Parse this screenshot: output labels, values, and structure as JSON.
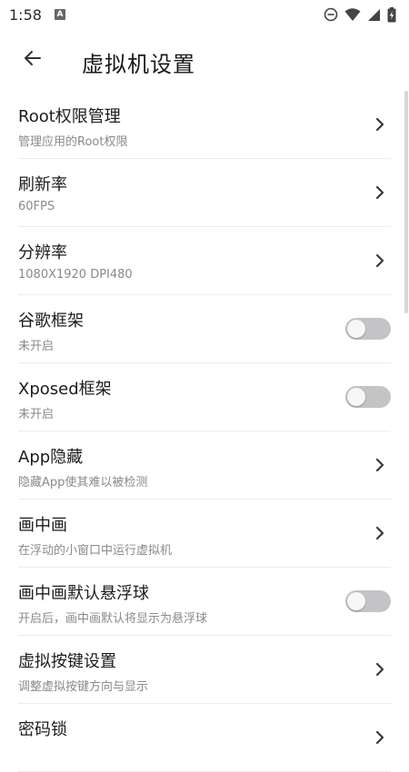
{
  "status_bar": {
    "time": "1:58",
    "notification_letter": "A"
  },
  "header": {
    "title": "虚拟机设置"
  },
  "settings": [
    {
      "title": "Root权限管理",
      "subtitle": "管理应用的Root权限",
      "control": "chevron"
    },
    {
      "title": "刷新率",
      "subtitle": "60FPS",
      "control": "chevron"
    },
    {
      "title": "分辨率",
      "subtitle": "1080X1920 DPI480",
      "control": "chevron"
    },
    {
      "title": "谷歌框架",
      "subtitle": "未开启",
      "control": "switch",
      "on": false
    },
    {
      "title": "Xposed框架",
      "subtitle": "未开启",
      "control": "switch",
      "on": false
    },
    {
      "title": "App隐藏",
      "subtitle": "隐藏App使其难以被检测",
      "control": "chevron"
    },
    {
      "title": "画中画",
      "subtitle": "在浮动的小窗口中运行虚拟机",
      "control": "chevron"
    },
    {
      "title": "画中画默认悬浮球",
      "subtitle": "开启后，画中画默认将显示为悬浮球",
      "control": "switch",
      "on": false
    },
    {
      "title": "虚拟按键设置",
      "subtitle": "调整虚拟按键方向与显示",
      "control": "chevron"
    },
    {
      "title": "密码锁",
      "subtitle": "",
      "control": "chevron"
    }
  ],
  "colors": {
    "switch_off_track": "#c4c4c6",
    "divider": "#ececec",
    "subtitle": "#8a8a8a"
  }
}
